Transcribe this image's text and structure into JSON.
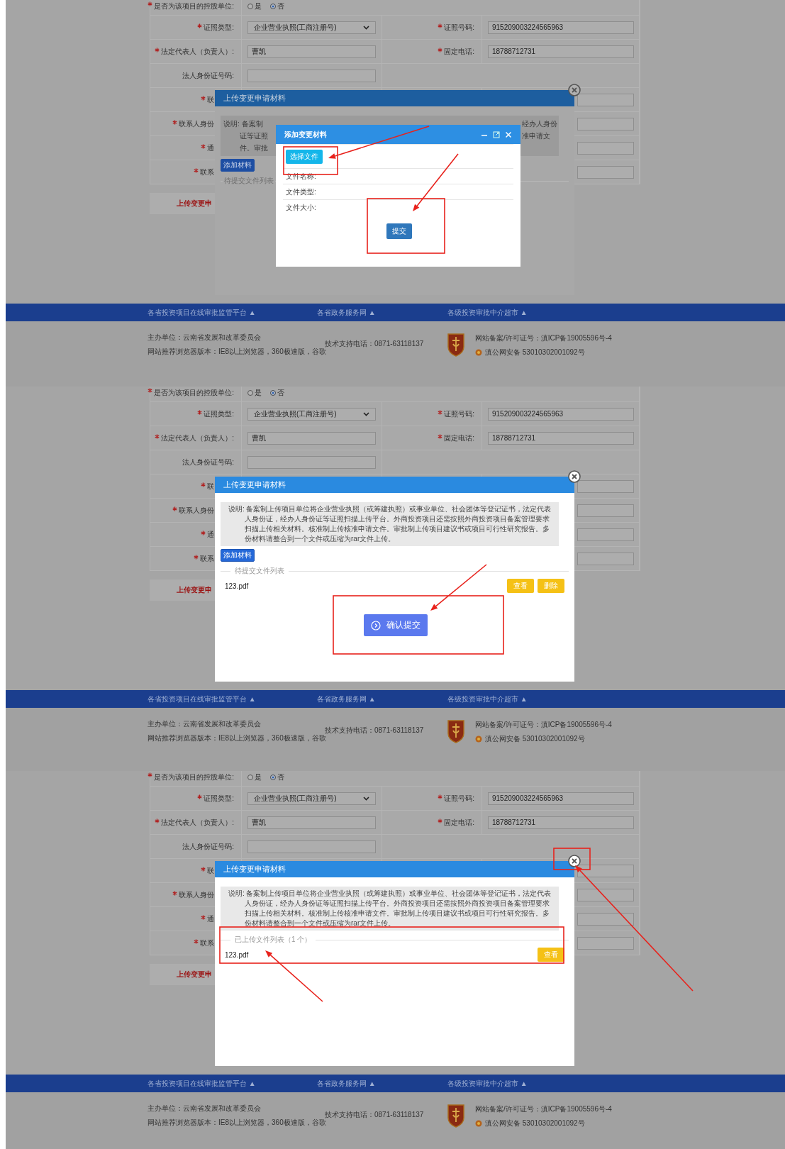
{
  "panels": [
    {
      "form": {
        "rows": [
          {
            "kind": "radio",
            "required": true,
            "label": "是否为该项目的控股单位:",
            "options": [
              {
                "label": "是",
                "selected": false
              },
              {
                "label": "否",
                "selected": true
              }
            ]
          },
          {
            "kind": "pair",
            "required": true,
            "label": "证照类型:",
            "field": {
              "kind": "select",
              "value": "企业营业执照(工商注册号)"
            },
            "required2": true,
            "label2": "证照号码:",
            "field2": {
              "kind": "input",
              "value": "915209003224565963"
            }
          },
          {
            "kind": "pair",
            "required": true,
            "label": "法定代表人（负责人）:",
            "field": {
              "kind": "input",
              "value": "曹凯"
            },
            "required2": true,
            "label2": "固定电话:",
            "field2": {
              "kind": "input",
              "value": "18788712731"
            }
          },
          {
            "kind": "single",
            "required": false,
            "label": "法人身份证号码:"
          },
          {
            "kind": "cut",
            "required": true,
            "label": "联"
          },
          {
            "kind": "cut",
            "required": true,
            "label": "联系人身份"
          },
          {
            "kind": "cut",
            "required": true,
            "label": "通"
          },
          {
            "kind": "cut",
            "required": true,
            "label": "联系"
          }
        ],
        "band": "上传变更申"
      },
      "modal": {
        "title": "上传变更申请材料",
        "note": {
          "kind": "split",
          "lines": [
            {
              "left": "说明: 备案制",
              "right": "经办人身份"
            },
            {
              "left": "证等证照",
              "right": "准申请文"
            },
            {
              "left": "件。审批"
            }
          ]
        },
        "add_button": "添加材料",
        "list": {
          "legend": "待提交文件列表"
        }
      },
      "dialog": {
        "title": "添加变更材料",
        "choose_button": "选择文件",
        "fields": [
          "文件名称:",
          "文件类型:",
          "文件大小:"
        ],
        "submit": "提交"
      },
      "footer": {
        "links": [
          "各省投资项目在线审批监管平台 ▲",
          "各省政务服务网 ▲",
          "各级投资审批中介超市 ▲"
        ],
        "sponsor": "主办单位：云南省发展和改革委员会",
        "browser": "网站推荐浏览器版本：IE8以上浏览器，360极速版，谷歌",
        "phone": "技术支持电话：0871-63118137",
        "icp": "网站备案/许可证号：滇ICP备19005596号-4",
        "police": "滇公网安备 53010302001092号"
      }
    },
    {
      "form": {
        "rows": [
          {
            "kind": "radio",
            "required": true,
            "label": "是否为该项目的控股单位:",
            "options": [
              {
                "label": "是",
                "selected": false
              },
              {
                "label": "否",
                "selected": true
              }
            ]
          },
          {
            "kind": "pair",
            "required": true,
            "label": "证照类型:",
            "field": {
              "kind": "select",
              "value": "企业营业执照(工商注册号)"
            },
            "required2": true,
            "label2": "证照号码:",
            "field2": {
              "kind": "input",
              "value": "915209003224565963"
            }
          },
          {
            "kind": "pair",
            "required": true,
            "label": "法定代表人（负责人）:",
            "field": {
              "kind": "input",
              "value": "曹凯"
            },
            "required2": true,
            "label2": "固定电话:",
            "field2": {
              "kind": "input",
              "value": "18788712731"
            }
          },
          {
            "kind": "single",
            "required": false,
            "label": "法人身份证号码:"
          },
          {
            "kind": "cut",
            "required": true,
            "label": "联"
          },
          {
            "kind": "cut",
            "required": true,
            "label": "联系人身份"
          },
          {
            "kind": "cut",
            "required": true,
            "label": "通"
          },
          {
            "kind": "cut",
            "required": true,
            "label": "联系"
          }
        ],
        "band": "上传变更申"
      },
      "modal": {
        "title": "上传变更申请材料",
        "note": {
          "kind": "full",
          "head": "说明:",
          "text": "备案制上传项目单位将企业营业执照（或筹建执照）或事业单位、社会团体等登记证书，法定代表人身份证，经办人身份证等证照扫描上传平台。外商投资项目还需按照外商投资项目备案管理要求扫描上传相关材料。核准制上传核准申请文件。审批制上传项目建议书或项目可行性研究报告。多份材料请整合到一个文件或压缩为rar文件上传。"
        },
        "add_button": "添加材料",
        "list": {
          "legend": "待提交文件列表",
          "files": [
            {
              "name": "123.pdf",
              "actions": [
                "查看",
                "删除"
              ]
            }
          ]
        },
        "confirm_button": "确认提交"
      },
      "footer": {
        "links": [
          "各省投资项目在线审批监管平台 ▲",
          "各省政务服务网 ▲",
          "各级投资审批中介超市 ▲"
        ],
        "sponsor": "主办单位：云南省发展和改革委员会",
        "browser": "网站推荐浏览器版本：IE8以上浏览器，360极速版，谷歌",
        "phone": "技术支持电话：0871-63118137",
        "icp": "网站备案/许可证号：滇ICP备19005596号-4",
        "police": "滇公网安备 53010302001092号"
      }
    },
    {
      "form": {
        "rows": [
          {
            "kind": "radio",
            "required": true,
            "label": "是否为该项目的控股单位:",
            "options": [
              {
                "label": "是",
                "selected": false
              },
              {
                "label": "否",
                "selected": true
              }
            ]
          },
          {
            "kind": "pair",
            "required": true,
            "label": "证照类型:",
            "field": {
              "kind": "select",
              "value": "企业营业执照(工商注册号)"
            },
            "required2": true,
            "label2": "证照号码:",
            "field2": {
              "kind": "input",
              "value": "915209003224565963"
            }
          },
          {
            "kind": "pair",
            "required": true,
            "label": "法定代表人（负责人）:",
            "field": {
              "kind": "input",
              "value": "曹凯"
            },
            "required2": true,
            "label2": "固定电话:",
            "field2": {
              "kind": "input",
              "value": "18788712731"
            }
          },
          {
            "kind": "single",
            "required": false,
            "label": "法人身份证号码:"
          },
          {
            "kind": "cut",
            "required": true,
            "label": "联"
          },
          {
            "kind": "cut",
            "required": true,
            "label": "联系人身份"
          },
          {
            "kind": "cut",
            "required": true,
            "label": "通"
          },
          {
            "kind": "cut",
            "required": true,
            "label": "联系"
          }
        ],
        "band": "上传变更申"
      },
      "modal": {
        "title": "上传变更申请材料",
        "note": {
          "kind": "full",
          "head": "说明:",
          "text": "备案制上传项目单位将企业营业执照（或筹建执照）或事业单位、社会团体等登记证书，法定代表人身份证，经办人身份证等证照扫描上传平台。外商投资项目还需按照外商投资项目备案管理要求扫描上传相关材料。核准制上传核准申请文件。审批制上传项目建议书或项目可行性研究报告。多份材料请整合到一个文件或压缩为rar文件上传。"
        },
        "list": {
          "legend": "已上传文件列表（1 个）",
          "files": [
            {
              "name": "123.pdf",
              "actions": [
                "查看"
              ]
            }
          ]
        }
      },
      "footer": {
        "links": [
          "各省投资项目在线审批监管平台 ▲",
          "各省政务服务网 ▲",
          "各级投资审批中介超市 ▲"
        ],
        "sponsor": "主办单位：云南省发展和改革委员会",
        "browser": "网站推荐浏览器版本：IE8以上浏览器，360极速版，谷歌",
        "phone": "技术支持电话：0871-63118137",
        "icp": "网站备案/许可证号：滇ICP备19005596号-4",
        "police": "滇公网安备 53010302001092号"
      }
    }
  ]
}
